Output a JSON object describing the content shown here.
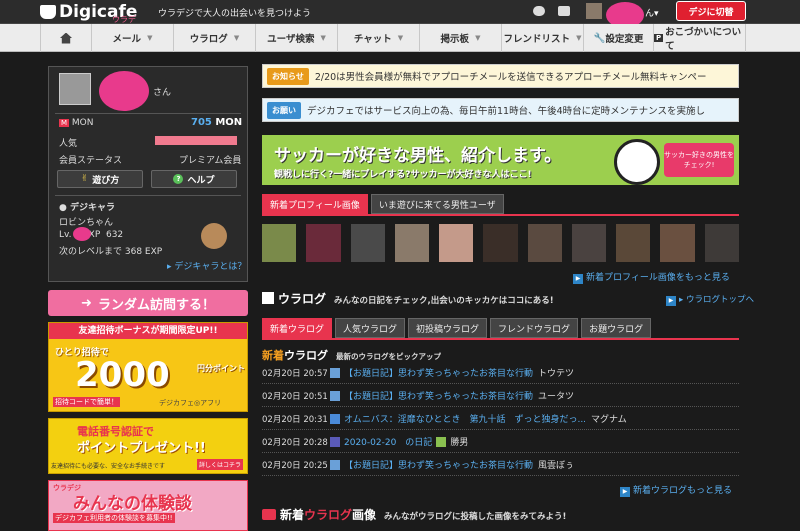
{
  "header": {
    "logo": "Digicafe",
    "logo_sub": "ウラデジ",
    "tagline": "ウラデジで大人の出会いを見つけよう",
    "user_suffix": "ん",
    "logout_label": "デジに切替"
  },
  "nav": {
    "items": [
      "メール",
      "ウラログ",
      "ユーザ検索",
      "チャット",
      "掲示板",
      "フレンドリスト",
      "設定変更",
      "おこづかいについて"
    ]
  },
  "profile": {
    "name_suffix": "さん",
    "currency": "MON",
    "mon_value": "705",
    "mon_unit": "MON",
    "popularity_label": "人気",
    "popularity_level": 1.0,
    "status_label": "会員ステータス",
    "status_value": "プレミアム会員",
    "howto_label": "遊び方",
    "help_label": "ヘルプ"
  },
  "digichara": {
    "title": "デジキャラ",
    "name": "ロビンちゃん",
    "level_prefix": "Lv.",
    "exp_label": "EXP",
    "exp_value": "632",
    "next_level": "次のレベルまで 368 EXP",
    "about_link": "デジキャラとは？"
  },
  "sidebar_banners": {
    "random_visit": "ランダム訪問する！",
    "invite_line1": "友達招待ボーナスが期間限定UP!!",
    "invite_line2": "ひとり招待で",
    "invite_amount": "2000",
    "invite_unit": "円分ポイント",
    "invite_foot": "招待コードで簡単！",
    "invite_brand": "デジカフェ◎アフリ",
    "phone_line1": "電話番号認証で",
    "phone_line2": "ポイントプレゼント!!",
    "phone_foot": "友達招待にも必要な、安全なお手続きです",
    "phone_detail": "詳しくはコチラ",
    "taiken_tag": "ウラデジ",
    "taiken_title": "みんなの体験談",
    "taiken_foot": "デジカフェ利用者の体験談を募集中!!"
  },
  "notices": [
    {
      "tag": "お知らせ",
      "text": "2/20は男性会員様が無料でアプローチメールを送信できるアプローチメール無料キャンペー"
    },
    {
      "tag": "お願い",
      "text": "デジカフェではサービス向上の為、毎日午前11時台、午後4時台に定時メンテナンスを実施し"
    }
  ],
  "soccer_banner": {
    "title": "サッカーが好きな男性、紹介します。",
    "subtitle": "観戦しに行く?一緒にプレイする?サッカーが大好きな人はここ!",
    "tag": "サッカー好きの男性をチェック!"
  },
  "profile_tabs": [
    "新着プロフィール画像",
    "いま遊びに来てる男性ユーザ"
  ],
  "profile_more": "新着プロフィール画像をもっと見る",
  "uralog": {
    "title": "ウラログ",
    "desc": "みんなの日記をチェック,出会いのキッカケはココにある!",
    "top_link": "ウラログトップへ",
    "tabs": [
      "新着ウラログ",
      "人気ウラログ",
      "初投稿ウラログ",
      "フレンドウラログ",
      "お題ウラログ"
    ],
    "new_title_a": "新着",
    "new_title_b": "ウラログ",
    "new_desc": "最新のウラログをピックアップ",
    "entries": [
      {
        "date": "02月20日 20:57",
        "title": "【お題日記】思わず笑っちゃったお茶目な行動",
        "author": "トウテツ"
      },
      {
        "date": "02月20日 20:51",
        "title": "【お題日記】思わず笑っちゃったお茶目な行動",
        "author": "ユータツ"
      },
      {
        "date": "02月20日 20:31",
        "title": "オムニバス：淫靡なひととき　第九十話　ずっと独身だっ...",
        "author": "マグナム"
      },
      {
        "date": "02月20日 20:28",
        "title": "2020-02-20　の日記",
        "author": "勝男"
      },
      {
        "date": "02月20日 20:25",
        "title": "【お題日記】思わず笑っちゃったお茶目な行動",
        "author": "風雲ぼぅ"
      }
    ],
    "more": "新着ウラログもっと見る"
  },
  "image_section": {
    "title_a": "新着",
    "title_b": "ウラログ",
    "title_c": "画像",
    "desc": "みんながウラログに投稿した画像をみてみよう!"
  }
}
